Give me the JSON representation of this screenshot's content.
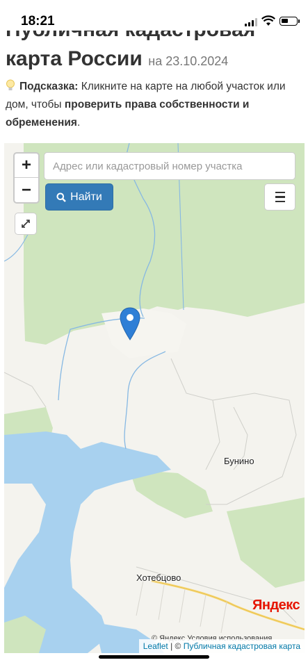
{
  "status_bar": {
    "time": "18:21"
  },
  "header": {
    "title_line1": "Публичная кадастровая",
    "title_line2": "карта России",
    "date": "на 23.10.2024"
  },
  "hint": {
    "label": "Подсказка:",
    "text1": " Кликните на карте на любой участок или дом, чтобы ",
    "bold": "проверить права собственности и обременения",
    "text2": "."
  },
  "map": {
    "zoom_in": "+",
    "zoom_out": "−",
    "search_placeholder": "Адрес или кадастровый номер участка",
    "find_label": "Найти",
    "places": {
      "bunino": "Бунино",
      "khotebtsovo": "Хотебцово"
    },
    "yandex_logo": "Яндекс",
    "yandex_terms": "© Яндекс  Условия использования",
    "attribution": {
      "leaflet": "Leaflet",
      "sep": " | © ",
      "pkk": "Публичная кадастровая карта"
    },
    "colors": {
      "forest": "#cfe5be",
      "water": "#a8d1ef",
      "land": "#f4f3ee",
      "accent": "#337ab7",
      "pin": "#2f7fd6"
    }
  }
}
